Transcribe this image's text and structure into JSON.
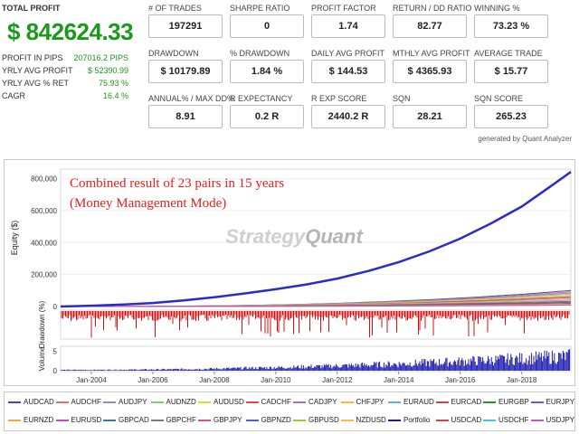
{
  "summary": {
    "total_profit_label": "TOTAL PROFIT",
    "total_profit_value": "$ 842624.33",
    "rows": [
      {
        "label": "PROFIT IN PIPS",
        "value": "207016.2 PIPS"
      },
      {
        "label": "YRLY AVG PROFIT",
        "value": "$ 52390.99"
      },
      {
        "label": "YRLY AVG % RET",
        "value": "75.93 %"
      },
      {
        "label": "CAGR",
        "value": "16.4 %"
      }
    ],
    "value_color": "#1a9a1a"
  },
  "metrics": [
    [
      {
        "label": "# OF TRADES",
        "value": "197291"
      },
      {
        "label": "SHARPE RATIO",
        "value": "0"
      },
      {
        "label": "PROFIT FACTOR",
        "value": "1.74"
      },
      {
        "label": "RETURN / DD RATIO",
        "value": "82.77"
      },
      {
        "label": "WINNING %",
        "value": "73.23 %"
      }
    ],
    [
      {
        "label": "DRAWDOWN",
        "value": "$ 10179.89"
      },
      {
        "label": "% DRAWDOWN",
        "value": "1.84 %"
      },
      {
        "label": "DAILY AVG PROFIT",
        "value": "$ 144.53"
      },
      {
        "label": "MTHLY AVG PROFIT",
        "value": "$ 4365.93"
      },
      {
        "label": "AVERAGE TRADE",
        "value": "$ 15.77"
      }
    ],
    [
      {
        "label": "ANNUAL% / MAX DD%",
        "value": "8.91"
      },
      {
        "label": "R EXPECTANCY",
        "value": "0.2 R"
      },
      {
        "label": "R EXP SCORE",
        "value": "2440.2 R"
      },
      {
        "label": "SQN",
        "value": "28.21"
      },
      {
        "label": "SQN SCORE",
        "value": "265.23"
      }
    ]
  ],
  "credit": "generated by Quant Analyzer",
  "chart_data": {
    "type": "line",
    "annotation_line1": "Combined result of 23 pairs in 15 years",
    "annotation_line2": "(Money Management Mode)",
    "watermark": "StrategyQuant",
    "watermark_left": "Strategy",
    "watermark_right": "Quant",
    "annotation_color": "#e8201c",
    "equity_panel": {
      "ylabel": "Equity ($)",
      "ylim": [
        0,
        860000
      ],
      "yticks": [
        0,
        200000,
        400000,
        600000,
        800000
      ],
      "ytick_labels": [
        "0",
        "200,000",
        "400,000",
        "600,000",
        "800,000"
      ],
      "portfolio_series": {
        "name": "Portfolio",
        "color": "#2b2bc8",
        "x": [
          2003.0,
          2004,
          2005,
          2006,
          2007,
          2008,
          2009,
          2010,
          2011,
          2012,
          2013,
          2014,
          2015,
          2016,
          2017,
          2018,
          2019,
          2019.6
        ],
        "y": [
          0,
          5000,
          12000,
          22000,
          38000,
          58000,
          82000,
          108000,
          138000,
          175000,
          222000,
          278000,
          345000,
          425000,
          520000,
          625000,
          760000,
          842624
        ]
      },
      "pair_series_end_values": [
        100000,
        92000,
        85000,
        78000,
        70000,
        62000,
        55000,
        48000,
        40000,
        32000,
        26000,
        20000,
        14000,
        9000
      ]
    },
    "drawdown_panel": {
      "ylabel": "Drawdown (%)",
      "color": "#d01010"
    },
    "volume_panel": {
      "ylabel": "Volume",
      "yticks": [
        0,
        5
      ],
      "ytick_labels": [
        "0",
        "5"
      ],
      "color": "#1818b0"
    },
    "x_axis": {
      "range": [
        2003.0,
        2019.6
      ],
      "ticks": [
        2004,
        2006,
        2008,
        2010,
        2012,
        2014,
        2016,
        2018
      ],
      "tick_labels": [
        "Jan-2004",
        "Jan-2006",
        "Jan-2008",
        "Jan-2010",
        "Jan-2012",
        "Jan-2014",
        "Jan-2016",
        "Jan-2018"
      ]
    },
    "legend": [
      {
        "name": "AUDCAD",
        "color": "#3b48c9"
      },
      {
        "name": "AUDCHF",
        "color": "#ef6a6a"
      },
      {
        "name": "AUDJPY",
        "color": "#8a8ad8"
      },
      {
        "name": "AUDNZD",
        "color": "#7dd36d"
      },
      {
        "name": "AUDUSD",
        "color": "#e8d23a"
      },
      {
        "name": "CADCHF",
        "color": "#e34a4a"
      },
      {
        "name": "CADJPY",
        "color": "#b36ad9"
      },
      {
        "name": "CHFJPY",
        "color": "#ffb347"
      },
      {
        "name": "EURAUD",
        "color": "#6aa7e6"
      },
      {
        "name": "EURCAD",
        "color": "#d24545"
      },
      {
        "name": "EURGBP",
        "color": "#2f8f2f"
      },
      {
        "name": "EURJPY",
        "color": "#8c4ec6"
      },
      {
        "name": "EURNZD",
        "color": "#f2a93b"
      },
      {
        "name": "EURUSD",
        "color": "#c04ec0"
      },
      {
        "name": "GBPCAD",
        "color": "#3a7a9a"
      },
      {
        "name": "GBPCHF",
        "color": "#7a7a7a"
      },
      {
        "name": "GBPJPY",
        "color": "#e05080"
      },
      {
        "name": "GBPNZD",
        "color": "#5a5ae0"
      },
      {
        "name": "GBPUSD",
        "color": "#9acb3a"
      },
      {
        "name": "NZDUSD",
        "color": "#e8c23a"
      },
      {
        "name": "Portfolio",
        "color": "#1c1c9c"
      },
      {
        "name": "USDCAD",
        "color": "#e04040"
      },
      {
        "name": "USDCHF",
        "color": "#4ac0e0"
      },
      {
        "name": "USDJPY",
        "color": "#b060d0"
      }
    ]
  }
}
